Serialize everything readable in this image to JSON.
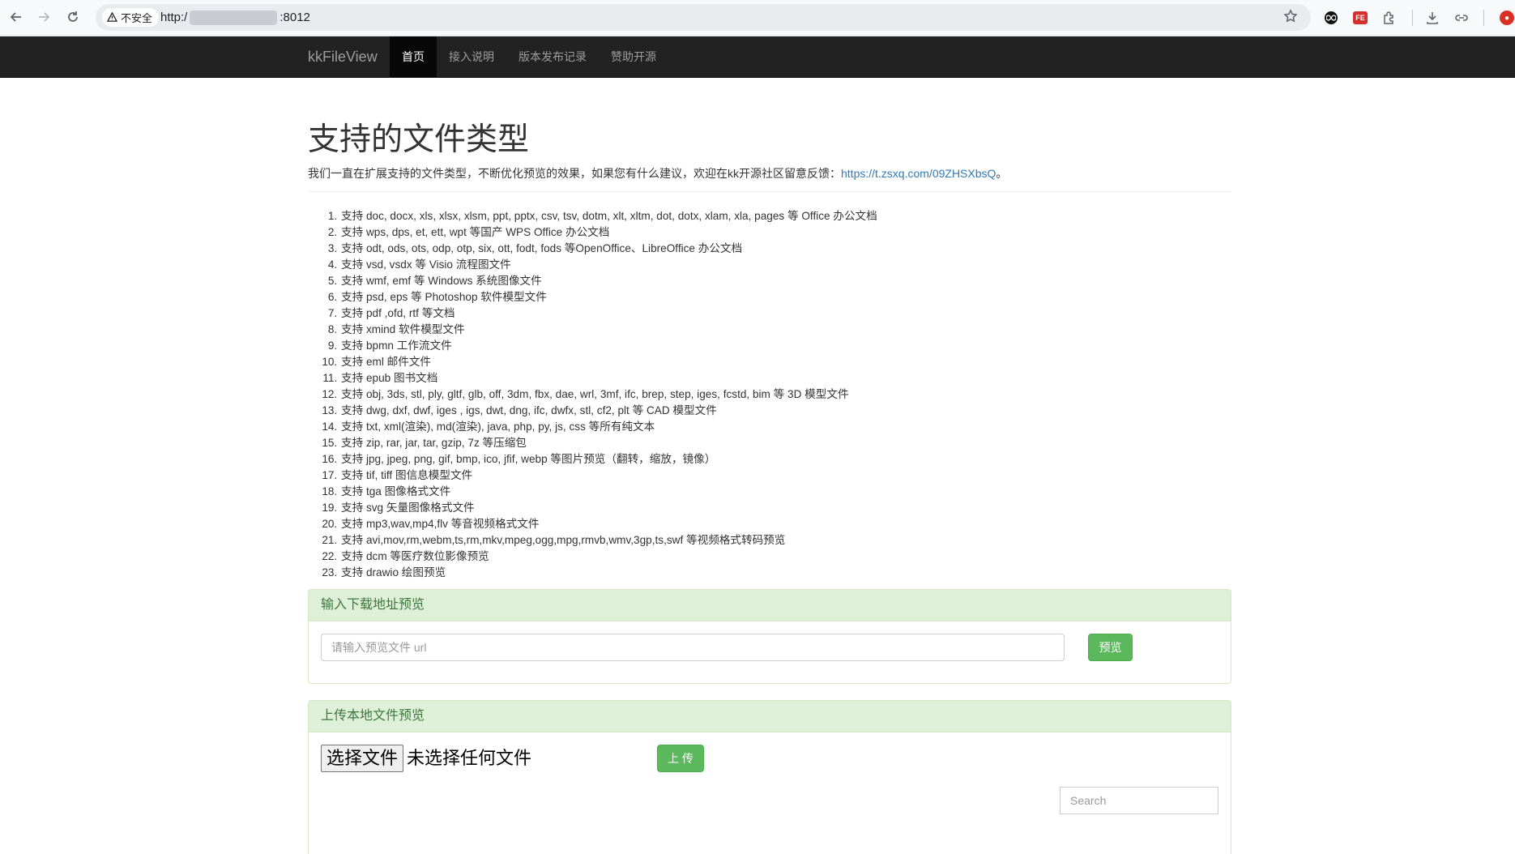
{
  "browser": {
    "security_label": "不安全",
    "url_prefix": "http:/",
    "url_suffix": ":8012"
  },
  "navbar": {
    "brand": "kkFileView",
    "items": [
      {
        "label": "首页",
        "active": true
      },
      {
        "label": "接入说明",
        "active": false
      },
      {
        "label": "版本发布记录",
        "active": false
      },
      {
        "label": "赞助开源",
        "active": false
      }
    ]
  },
  "header": {
    "title": "支持的文件类型",
    "intro": "我们一直在扩展支持的文件类型，不断优化预览的效果，如果您有什么建议，欢迎在kk开源社区留意反馈：",
    "intro_link": "https://t.zsxq.com/09ZHSXbsQ",
    "intro_end": "。"
  },
  "file_types": [
    "支持 doc, docx, xls, xlsx, xlsm, ppt, pptx, csv, tsv, dotm, xlt, xltm, dot, dotx, xlam, xla, pages 等 Office 办公文档",
    "支持 wps, dps, et, ett, wpt 等国产 WPS Office 办公文档",
    "支持 odt, ods, ots, odp, otp, six, ott, fodt, fods 等OpenOffice、LibreOffice 办公文档",
    "支持 vsd, vsdx 等 Visio 流程图文件",
    "支持 wmf, emf 等 Windows 系统图像文件",
    "支持 psd, eps 等 Photoshop 软件模型文件",
    "支持 pdf ,ofd, rtf 等文档",
    "支持 xmind 软件模型文件",
    "支持 bpmn 工作流文件",
    "支持 eml 邮件文件",
    "支持 epub 图书文档",
    "支持 obj, 3ds, stl, ply, gltf, glb, off, 3dm, fbx, dae, wrl, 3mf, ifc, brep, step, iges, fcstd, bim 等 3D 模型文件",
    "支持 dwg, dxf, dwf, iges , igs, dwt, dng, ifc, dwfx, stl, cf2, plt 等 CAD 模型文件",
    "支持 txt, xml(渲染), md(渲染), java, php, py, js, css 等所有纯文本",
    "支持 zip, rar, jar, tar, gzip, 7z 等压缩包",
    "支持 jpg, jpeg, png, gif, bmp, ico, jfif, webp 等图片预览（翻转，缩放，镜像）",
    "支持 tif, tiff 图信息模型文件",
    "支持 tga 图像格式文件",
    "支持 svg 矢量图像格式文件",
    "支持 mp3,wav,mp4,flv 等音视频格式文件",
    "支持 avi,mov,rm,webm,ts,rm,mkv,mpeg,ogg,mpg,rmvb,wmv,3gp,ts,swf 等视频格式转码预览",
    "支持 dcm 等医疗数位影像预览",
    "支持 drawio 绘图预览"
  ],
  "url_panel": {
    "heading": "输入下载地址预览",
    "placeholder": "请输入预览文件 url",
    "button": "预览"
  },
  "upload_panel": {
    "heading": "上传本地文件预览",
    "choose_button": "选择文件",
    "no_file": "未选择任何文件",
    "upload_button": "上 传",
    "search_placeholder": "Search"
  },
  "colors": {
    "navbar_bg": "#222222",
    "panel_heading_bg": "#dff0d8",
    "success_button": "#5cb85c",
    "link": "#337ab7"
  }
}
